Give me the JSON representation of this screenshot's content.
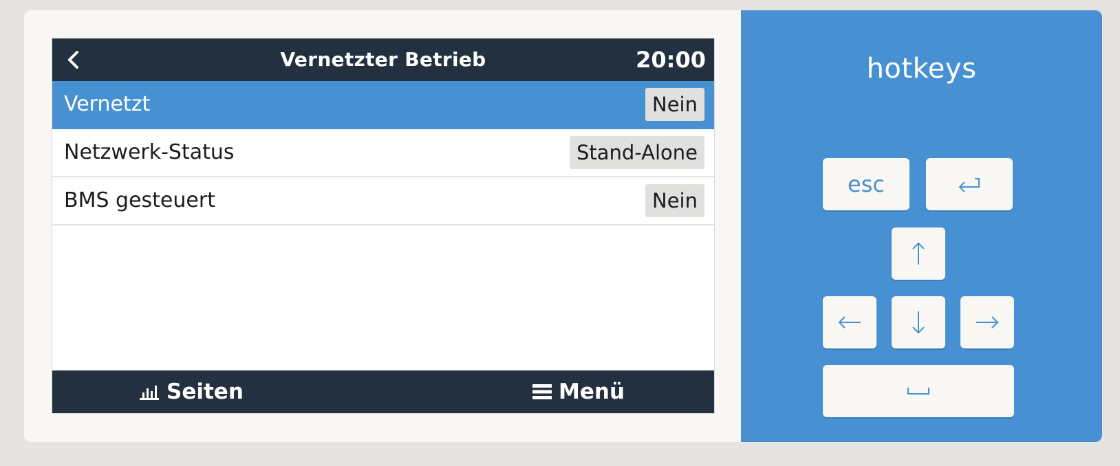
{
  "screen": {
    "title": "Vernetzter Betrieb",
    "clock": "20:00",
    "rows": [
      {
        "label": "Vernetzt",
        "value": "Nein",
        "selected": true
      },
      {
        "label": "Netzwerk-Status",
        "value": "Stand-Alone",
        "selected": false
      },
      {
        "label": "BMS gesteuert",
        "value": "Nein",
        "selected": false
      }
    ],
    "bottom": {
      "pages_label": "Seiten",
      "menu_label": "Menü"
    }
  },
  "hotkeys": {
    "title": "hotkeys",
    "esc_label": "esc",
    "enter_icon": "enter-icon",
    "up_icon": "arrow-up-icon",
    "left_icon": "arrow-left-icon",
    "down_icon": "arrow-down-icon",
    "right_icon": "arrow-right-icon",
    "space_icon": "space-icon"
  },
  "colors": {
    "accent": "#4790d2",
    "header": "#22303f",
    "page_bg": "#e5e4e0",
    "panel_bg": "#f8f7f4"
  }
}
